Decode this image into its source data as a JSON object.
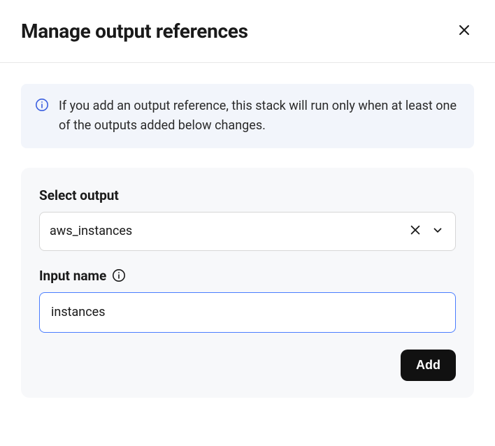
{
  "header": {
    "title": "Manage output references"
  },
  "info": {
    "text": "If you add an output reference, this stack will run only when at least one of the outputs added below changes."
  },
  "form": {
    "select_output": {
      "label": "Select output",
      "value": "aws_instances"
    },
    "input_name": {
      "label": "Input name",
      "value": "instances"
    },
    "add_label": "Add"
  }
}
